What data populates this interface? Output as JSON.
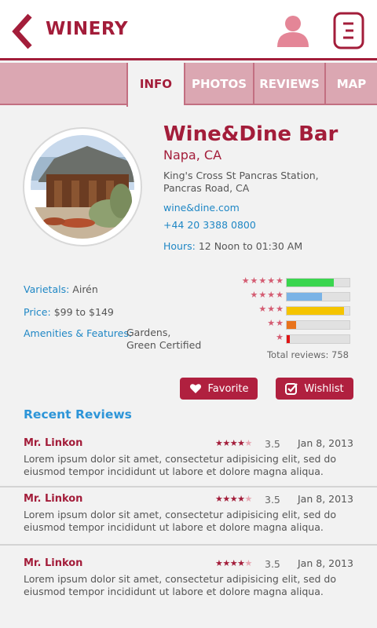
{
  "header": {
    "title": "WINERY"
  },
  "tabs": [
    {
      "label": "INFO",
      "active": true
    },
    {
      "label": "PHOTOS",
      "active": false
    },
    {
      "label": "REVIEWS",
      "active": false
    },
    {
      "label": "MAP",
      "active": false
    }
  ],
  "venue": {
    "name": "Wine&Dine Bar",
    "city": "Napa, CA",
    "address_line1": "King's Cross St Pancras Station,",
    "address_line2": "Pancras Road, CA",
    "website": "wine&dine.com",
    "phone": "+44 20 3388 0800",
    "hours_label": "Hours:",
    "hours_value": "12 Noon to 01:30 AM"
  },
  "details": {
    "varietals_label": "Varietals:",
    "varietals_value": "Airén",
    "price_label": "Price:",
    "price_value": "$99 to $149",
    "amenities_label": "Amenities & Features:",
    "amenities_line1": "Gardens,",
    "amenities_line2": "Green Certified"
  },
  "ratings": {
    "rows": [
      {
        "stars": "★★★★★",
        "fraction": 0.75,
        "color": "#3ad64f"
      },
      {
        "stars": "★★★★",
        "fraction": 0.56,
        "color": "#7ab3e6"
      },
      {
        "stars": "★★★",
        "fraction": 0.91,
        "color": "#f5c400"
      },
      {
        "stars": "★★",
        "fraction": 0.15,
        "color": "#e8731c"
      },
      {
        "stars": "★",
        "fraction": 0.05,
        "color": "#e01515"
      }
    ],
    "total_label": "Total reviews: 758"
  },
  "actions": {
    "favorite_label": "Favorite",
    "wishlist_label": "Wishlist"
  },
  "reviews_section": {
    "title": "Recent Reviews",
    "items": [
      {
        "author": "Mr. Linkon",
        "rating": "3.5",
        "date": "Jan 8, 2013",
        "text": "Lorem ipsum dolor sit amet, consectetur adipisicing elit, sed do eiusmod tempor incididunt ut labore et dolore magna aliqua."
      },
      {
        "author": "Mr. Linkon",
        "rating": "3.5",
        "date": "Jan 8, 2013",
        "text": "Lorem ipsum dolor sit amet, consectetur adipisicing elit, sed do eiusmod tempor incididunt ut labore et dolore magna aliqua."
      },
      {
        "author": "Mr. Linkon",
        "rating": "3.5",
        "date": "Jan 8, 2013",
        "text": "Lorem ipsum dolor sit amet, consectetur adipisicing elit, sed do eiusmod tempor incididunt ut labore et dolore magna aliqua."
      }
    ]
  },
  "colors": {
    "brand": "#a31d3a",
    "accent": "#1f87c5",
    "tab_bg": "#dba7b2"
  },
  "icons": {
    "back": "chevron-left-icon",
    "profile": "user-icon",
    "menu": "menu-icon",
    "favorite": "heart-icon",
    "wishlist": "checkbox-icon"
  }
}
